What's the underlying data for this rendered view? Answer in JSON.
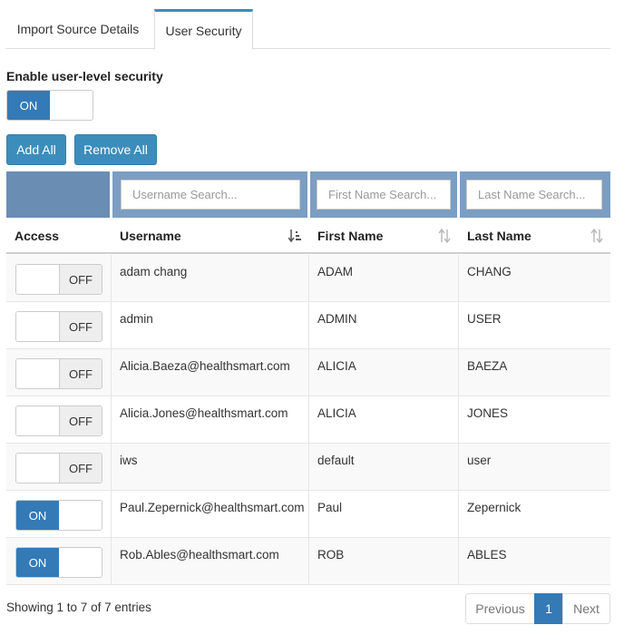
{
  "tabs": [
    {
      "label": "Import Source Details"
    },
    {
      "label": "User Security"
    }
  ],
  "security": {
    "enable_label": "Enable user-level security",
    "enable_state": "ON"
  },
  "actions": {
    "add_all": "Add All",
    "remove_all": "Remove All"
  },
  "search": {
    "username_placeholder": "Username Search...",
    "first_name_placeholder": "First Name Search...",
    "last_name_placeholder": "Last Name Search..."
  },
  "columns": {
    "access": "Access",
    "username": "Username",
    "first_name": "First Name",
    "last_name": "Last Name"
  },
  "rows": [
    {
      "access": "OFF",
      "username": "adam chang",
      "first_name": "ADAM",
      "last_name": "CHANG"
    },
    {
      "access": "OFF",
      "username": "admin",
      "first_name": "ADMIN",
      "last_name": "USER"
    },
    {
      "access": "OFF",
      "username": "Alicia.Baeza@healthsmart.com",
      "first_name": "ALICIA",
      "last_name": "BAEZA"
    },
    {
      "access": "OFF",
      "username": "Alicia.Jones@healthsmart.com",
      "first_name": "ALICIA",
      "last_name": "JONES"
    },
    {
      "access": "OFF",
      "username": "iws",
      "first_name": "default",
      "last_name": "user"
    },
    {
      "access": "ON",
      "username": "Paul.Zepernick@healthsmart.com",
      "first_name": "Paul",
      "last_name": "Zepernick"
    },
    {
      "access": "ON",
      "username": "Rob.Ables@healthsmart.com",
      "first_name": "ROB",
      "last_name": "ABLES"
    }
  ],
  "footer": {
    "info": "Showing 1 to 7 of 7 entries",
    "previous": "Previous",
    "page": "1",
    "next": "Next"
  },
  "colors": {
    "primary": "#337ab7",
    "button": "#3c8dbc",
    "search_band": "#7b9ec2"
  }
}
